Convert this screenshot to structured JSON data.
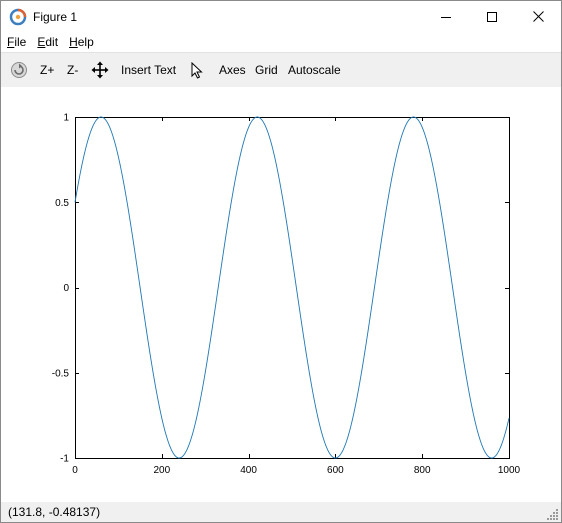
{
  "window": {
    "title": "Figure 1",
    "controls": {
      "minimize": "minimize",
      "maximize": "maximize",
      "close": "close"
    }
  },
  "menu": [
    {
      "mnemonic": "F",
      "rest": "ile"
    },
    {
      "mnemonic": "E",
      "rest": "dit"
    },
    {
      "mnemonic": "H",
      "rest": "elp"
    }
  ],
  "toolbar": {
    "rotate_icon": "rotate-icon",
    "zoom_in": "Z+",
    "zoom_out": "Z-",
    "pan_icon": "pan-icon",
    "insert_text": "Insert Text",
    "select_icon": "cursor-icon",
    "axes": "Axes",
    "grid": "Grid",
    "autoscale": "Autoscale"
  },
  "status": {
    "coordinates": "(131.8, -0.48137)"
  },
  "colors": {
    "line": "#1f77b4",
    "toolbar_bg": "#f0f0f0",
    "accent_icon": "#e06030"
  },
  "chart_data": {
    "type": "line",
    "title": "",
    "xlabel": "",
    "ylabel": "",
    "xlim": [
      0,
      1000
    ],
    "ylim": [
      -1,
      1
    ],
    "xticks": [
      0,
      200,
      400,
      600,
      800,
      1000
    ],
    "yticks": [
      -1,
      -0.5,
      0,
      0.5,
      1
    ],
    "xtick_labels": [
      "0",
      "200",
      "400",
      "600",
      "800",
      "1000"
    ],
    "ytick_labels": [
      "-1",
      "-0.5",
      "0",
      "0.5",
      "1"
    ],
    "grid": false,
    "legend": "none",
    "series": [
      {
        "function": "sin",
        "amplitude": 1,
        "period": 360,
        "phase_deg": 30,
        "x_start": 0,
        "x_end": 1000,
        "peaks_x": [
          60,
          420,
          780
        ],
        "troughs_x": [
          240,
          600,
          960
        ]
      }
    ]
  }
}
